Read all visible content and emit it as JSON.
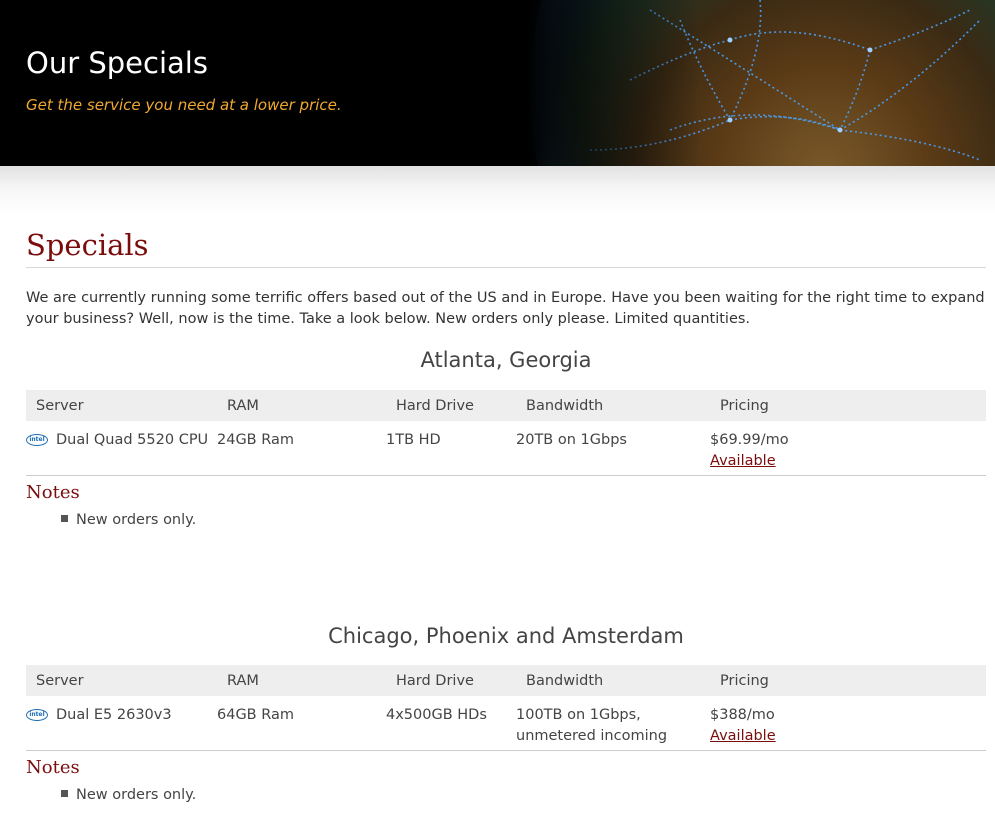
{
  "banner": {
    "title": "Our Specials",
    "subtitle": "Get the service you need at a lower price."
  },
  "page": {
    "heading": "Specials",
    "intro": "We are currently running some terrific offers based out of the US and in Europe. Have you been waiting for the right time to expand your business? Well, now is the time. Take a look below. New orders only please. Limited quantities."
  },
  "table_headers": {
    "server": "Server",
    "ram": "RAM",
    "hard_drive": "Hard Drive",
    "bandwidth": "Bandwidth",
    "pricing": "Pricing"
  },
  "specials": [
    {
      "region": "Atlanta, Georgia",
      "icon": "intel-icon",
      "server": "Dual Quad 5520 CPU",
      "ram": "24GB Ram",
      "hard_drive": "1TB HD",
      "bandwidth": "20TB on 1Gbps",
      "price": "$69.99/mo",
      "availability": "Available",
      "notes_title": "Notes",
      "notes": [
        "New orders only."
      ]
    },
    {
      "region": "Chicago, Phoenix and Amsterdam",
      "icon": "intel-icon",
      "server": "Dual E5 2630v3",
      "ram": "64GB Ram",
      "hard_drive": "4x500GB HDs",
      "bandwidth": "100TB on 1Gbps, unmetered incoming",
      "price": "$388/mo",
      "availability": "Available",
      "notes_title": "Notes",
      "notes": [
        "New orders only."
      ]
    }
  ],
  "colors": {
    "heading": "#7a0c0c",
    "subtitle": "#f0a830",
    "banner_bg": "#000000"
  }
}
